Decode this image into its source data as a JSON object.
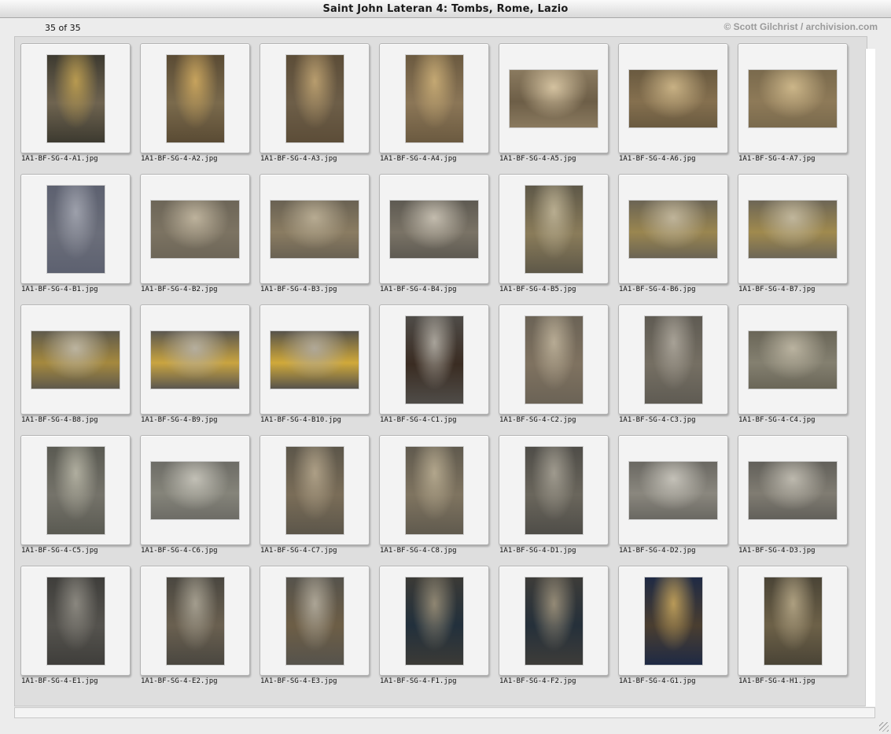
{
  "window": {
    "title": "Saint John Lateran 4: Tombs, Rome, Lazio",
    "count": "35 of 35",
    "credit": "© Scott Gilchrist / archivision.com"
  },
  "thumbnails": [
    {
      "file": "1A1-BF-SG-4-A1.jpg",
      "orientation": "portrait",
      "colors": [
        "#3d3a30",
        "#b89a50",
        "#6f6450"
      ]
    },
    {
      "file": "1A1-BF-SG-4-A2.jpg",
      "orientation": "portrait",
      "colors": [
        "#5a4b34",
        "#c7a35d",
        "#7a6a4c"
      ]
    },
    {
      "file": "1A1-BF-SG-4-A3.jpg",
      "orientation": "portrait",
      "colors": [
        "#5c4d38",
        "#b89d6e",
        "#6d5e48"
      ]
    },
    {
      "file": "1A1-BF-SG-4-A4.jpg",
      "orientation": "portrait",
      "colors": [
        "#6b5a40",
        "#c4a873",
        "#8b7657"
      ]
    },
    {
      "file": "1A1-BF-SG-4-A5.jpg",
      "orientation": "landscape",
      "colors": [
        "#8a7a5f",
        "#d4c2a0",
        "#6d5e47"
      ]
    },
    {
      "file": "1A1-BF-SG-4-A6.jpg",
      "orientation": "landscape",
      "colors": [
        "#6a5a40",
        "#c8b184",
        "#85704f"
      ]
    },
    {
      "file": "1A1-BF-SG-4-A7.jpg",
      "orientation": "landscape",
      "colors": [
        "#7a6a4d",
        "#ccb689",
        "#8e7a58"
      ]
    },
    {
      "file": "1A1-BF-SG-4-B1.jpg",
      "orientation": "portrait",
      "colors": [
        "#5d6170",
        "#9da0ab",
        "#6b6e7a"
      ]
    },
    {
      "file": "1A1-BF-SG-4-B2.jpg",
      "orientation": "landscape",
      "colors": [
        "#6d6658",
        "#bdb29c",
        "#7c7362"
      ]
    },
    {
      "file": "1A1-BF-SG-4-B3.jpg",
      "orientation": "landscape",
      "colors": [
        "#6a6253",
        "#b7ab92",
        "#8a7c62"
      ]
    },
    {
      "file": "1A1-BF-SG-4-B4.jpg",
      "orientation": "landscape",
      "colors": [
        "#5e5a52",
        "#c3bcae",
        "#7a7366"
      ]
    },
    {
      "file": "1A1-BF-SG-4-B5.jpg",
      "orientation": "portrait",
      "colors": [
        "#5e5848",
        "#b8ad90",
        "#8a7c5a"
      ]
    },
    {
      "file": "1A1-BF-SG-4-B6.jpg",
      "orientation": "landscape",
      "colors": [
        "#6b6454",
        "#bfb49a",
        "#9a8650"
      ]
    },
    {
      "file": "1A1-BF-SG-4-B7.jpg",
      "orientation": "landscape",
      "colors": [
        "#6d6656",
        "#c0b69c",
        "#a08a4e"
      ]
    },
    {
      "file": "1A1-BF-SG-4-B8.jpg",
      "orientation": "landscape",
      "colors": [
        "#5f5a4c",
        "#bcb4a0",
        "#a5893e"
      ]
    },
    {
      "file": "1A1-BF-SG-4-B9.jpg",
      "orientation": "landscape",
      "colors": [
        "#5b5750",
        "#b5ae9e",
        "#c9a440"
      ]
    },
    {
      "file": "1A1-BF-SG-4-B10.jpg",
      "orientation": "landscape",
      "colors": [
        "#57534b",
        "#b0a898",
        "#d0a93a"
      ]
    },
    {
      "file": "1A1-BF-SG-4-C1.jpg",
      "orientation": "portrait",
      "colors": [
        "#4f4c48",
        "#a8a39a",
        "#3a2c22"
      ]
    },
    {
      "file": "1A1-BF-SG-4-C2.jpg",
      "orientation": "portrait",
      "colors": [
        "#6b6356",
        "#b7ab94",
        "#7f7260"
      ]
    },
    {
      "file": "1A1-BF-SG-4-C3.jpg",
      "orientation": "portrait",
      "colors": [
        "#5f5b53",
        "#a7a196",
        "#756f63"
      ]
    },
    {
      "file": "1A1-BF-SG-4-C4.jpg",
      "orientation": "landscape",
      "colors": [
        "#6a6658",
        "#bab3a0",
        "#848070"
      ]
    },
    {
      "file": "1A1-BF-SG-4-C5.jpg",
      "orientation": "portrait",
      "colors": [
        "#5a5a52",
        "#b0ae9f",
        "#75736a"
      ]
    },
    {
      "file": "1A1-BF-SG-4-C6.jpg",
      "orientation": "landscape",
      "colors": [
        "#6d6c66",
        "#c2c0b6",
        "#85847a"
      ]
    },
    {
      "file": "1A1-BF-SG-4-C7.jpg",
      "orientation": "portrait",
      "colors": [
        "#5c564a",
        "#ad9f86",
        "#7a6d58"
      ]
    },
    {
      "file": "1A1-BF-SG-4-C8.jpg",
      "orientation": "portrait",
      "colors": [
        "#605a4e",
        "#b2a68c",
        "#7f7460"
      ]
    },
    {
      "file": "1A1-BF-SG-4-D1.jpg",
      "orientation": "portrait",
      "colors": [
        "#4f4d48",
        "#9f9a8e",
        "#6a665c"
      ]
    },
    {
      "file": "1A1-BF-SG-4-D2.jpg",
      "orientation": "landscape",
      "colors": [
        "#6a6862",
        "#c4c1b8",
        "#8a877e"
      ]
    },
    {
      "file": "1A1-BF-SG-4-D3.jpg",
      "orientation": "landscape",
      "colors": [
        "#62605a",
        "#bdb9ae",
        "#807c72"
      ]
    },
    {
      "file": "1A1-BF-SG-4-E1.jpg",
      "orientation": "portrait",
      "colors": [
        "#3f3e3b",
        "#8a877f",
        "#55534e"
      ]
    },
    {
      "file": "1A1-BF-SG-4-E2.jpg",
      "orientation": "portrait",
      "colors": [
        "#4a4740",
        "#a39d8e",
        "#6a6050"
      ]
    },
    {
      "file": "1A1-BF-SG-4-E3.jpg",
      "orientation": "portrait",
      "colors": [
        "#56534c",
        "#aca596",
        "#6d5e46"
      ]
    },
    {
      "file": "1A1-BF-SG-4-F1.jpg",
      "orientation": "portrait",
      "colors": [
        "#3b3a36",
        "#8f8672",
        "#22303c"
      ]
    },
    {
      "file": "1A1-BF-SG-4-F2.jpg",
      "orientation": "portrait",
      "colors": [
        "#3d3c39",
        "#948a76",
        "#25303a"
      ]
    },
    {
      "file": "1A1-BF-SG-4-G1.jpg",
      "orientation": "portrait",
      "colors": [
        "#1f2a44",
        "#b99a58",
        "#4a3e30"
      ]
    },
    {
      "file": "1A1-BF-SG-4-H1.jpg",
      "orientation": "portrait",
      "colors": [
        "#4a4436",
        "#ad9f80",
        "#6d6148"
      ]
    }
  ]
}
